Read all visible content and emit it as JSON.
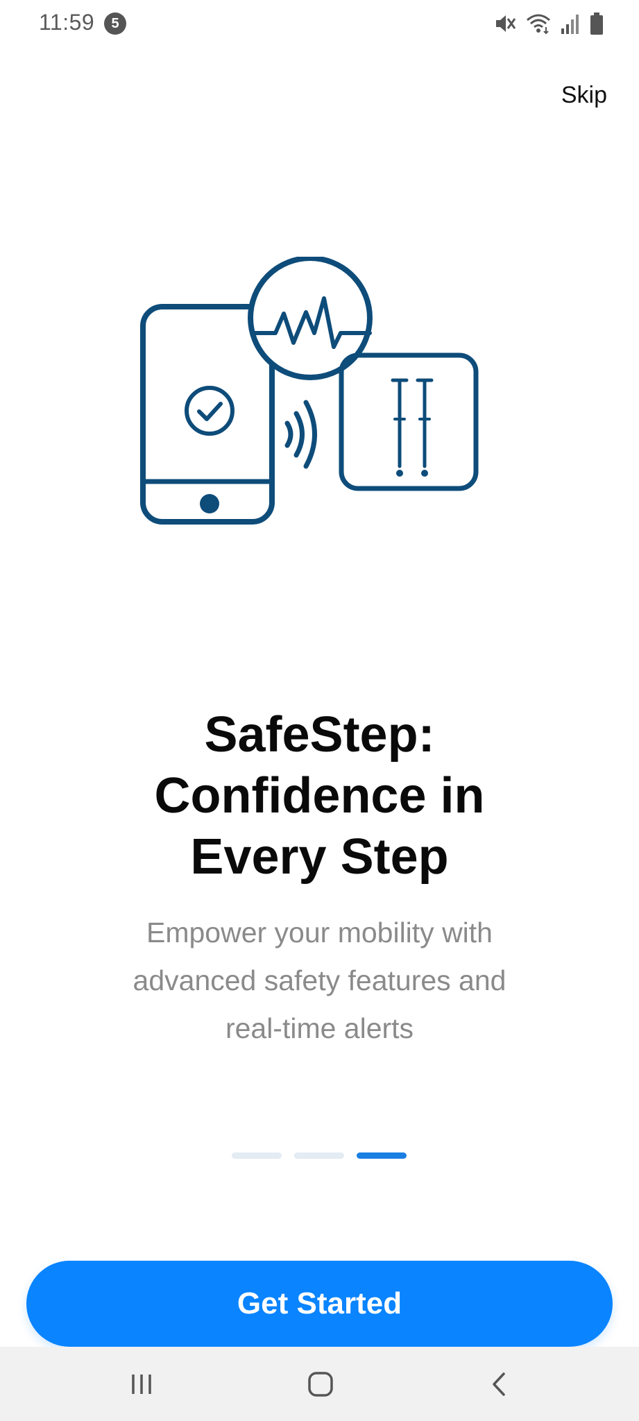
{
  "status_bar": {
    "time": "11:59",
    "notification_count": "5"
  },
  "onboarding": {
    "skip_label": "Skip",
    "title_lines": [
      "SafeStep:",
      "Confidence in",
      "Every Step"
    ],
    "subtitle_lines": [
      "Empower your mobility with",
      "advanced safety features and",
      "real-time alerts"
    ],
    "page_count": 3,
    "current_page": 3,
    "cta_label": "Get Started"
  },
  "colors": {
    "accent": "#0a84ff",
    "illustration": "#0e4c7a",
    "indicator_active": "#1a7fe3",
    "indicator_inactive": "#e3ebf3"
  }
}
